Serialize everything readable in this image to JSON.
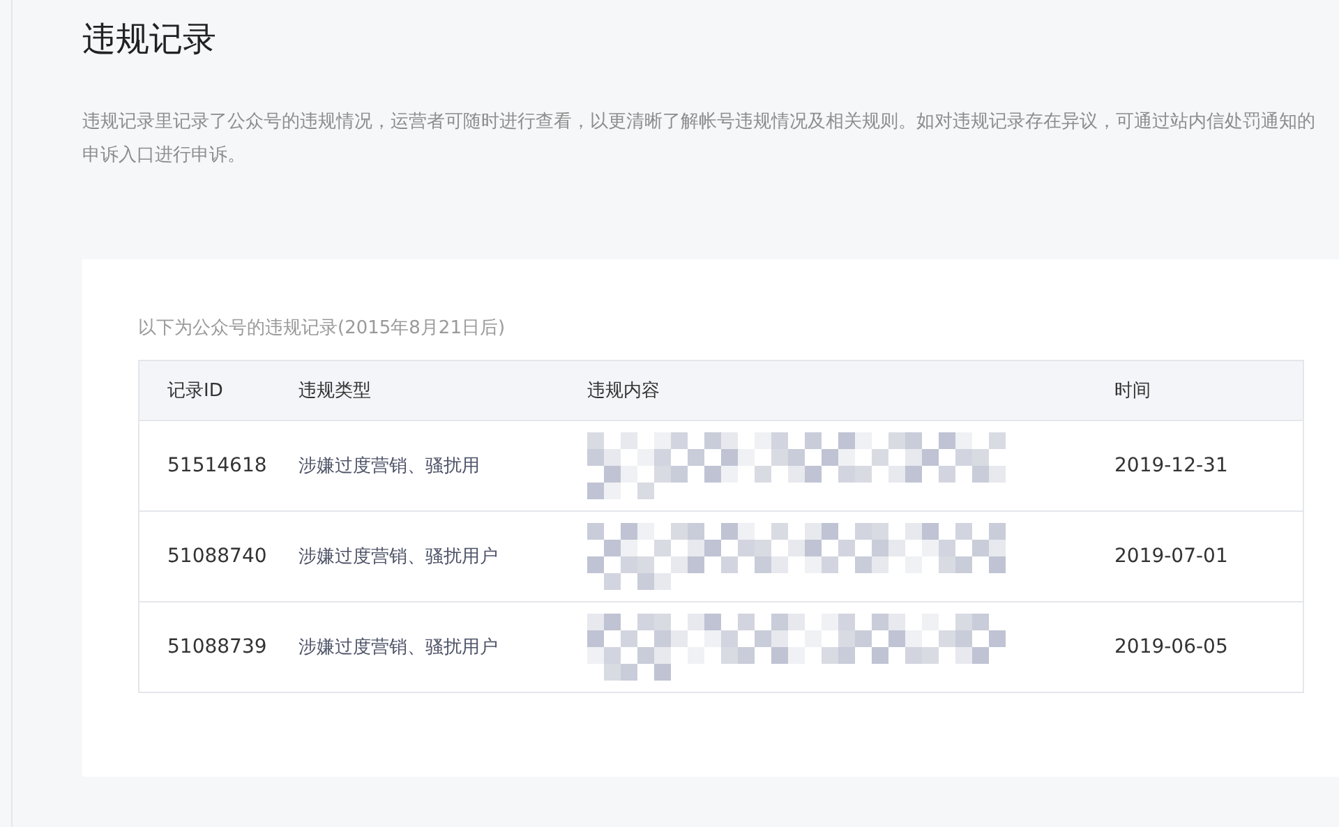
{
  "page": {
    "title": "违规记录",
    "description": "违规记录里记录了公众号的违规情况，运营者可随时进行查看，以更清晰了解帐号违规情况及相关规则。如对违规记录存在异议，可通过站内信处罚通知的申诉入口进行申诉。"
  },
  "records": {
    "caption": "以下为公众号的违规记录(2015年8月21日后)",
    "columns": [
      "记录ID",
      "违规类型",
      "违规内容",
      "时间"
    ],
    "rows": [
      {
        "id": "51514618",
        "type": "涉嫌过度营销、骚扰用",
        "time": "2019-12-31"
      },
      {
        "id": "51088740",
        "type": "涉嫌过度营销、骚扰用户",
        "time": "2019-07-01"
      },
      {
        "id": "51088739",
        "type": "涉嫌过度营销、骚扰用户",
        "time": "2019-06-05"
      }
    ]
  }
}
